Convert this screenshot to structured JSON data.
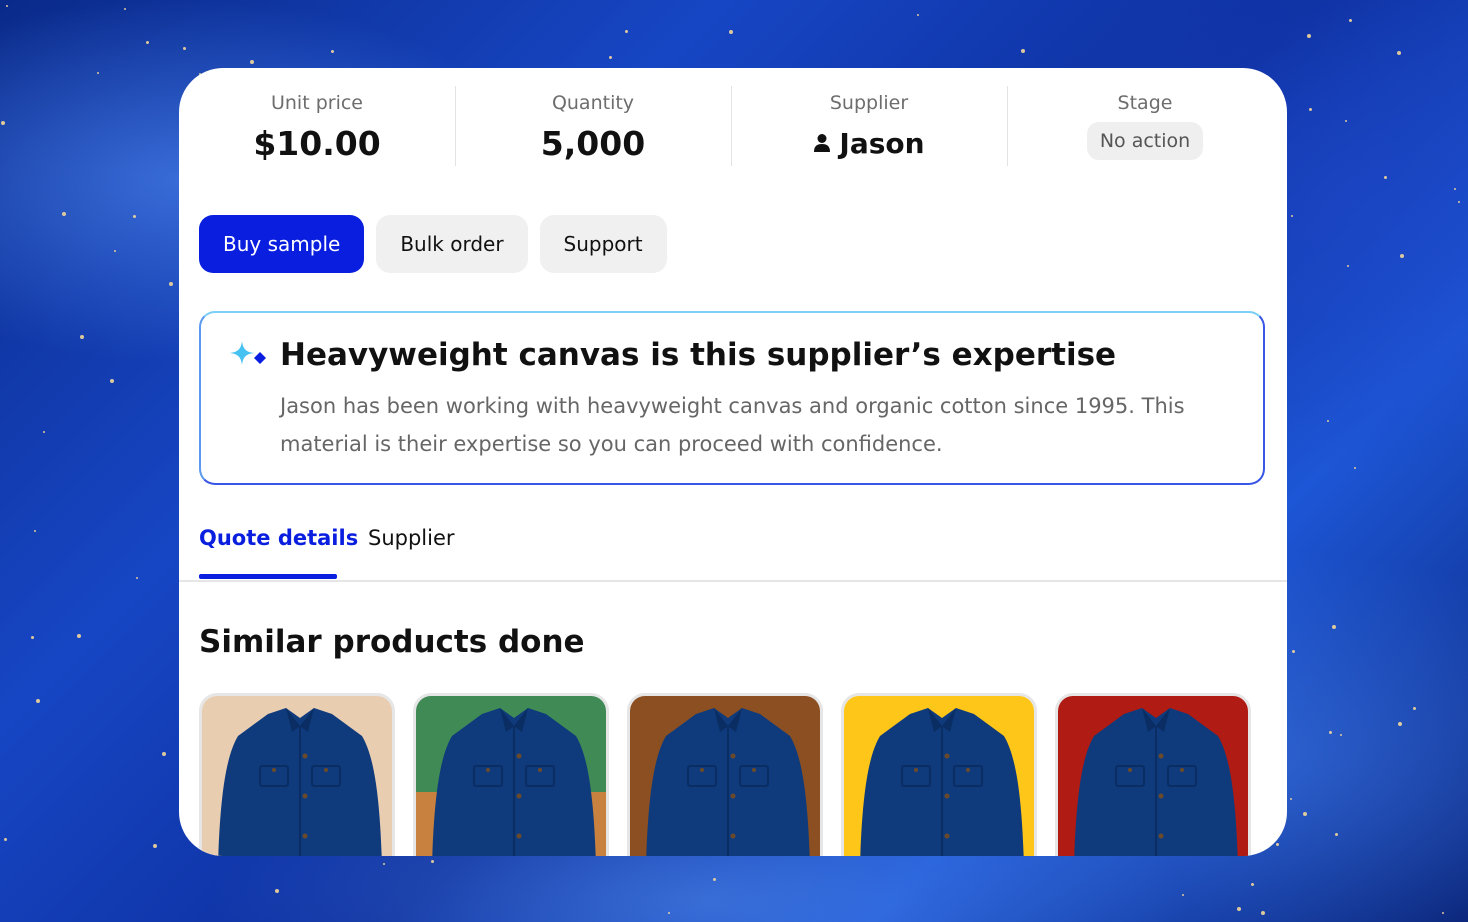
{
  "stats": {
    "unit_price": {
      "label": "Unit price",
      "value": "$10.00"
    },
    "quantity": {
      "label": "Quantity",
      "value": "5,000"
    },
    "supplier": {
      "label": "Supplier",
      "value": "Jason",
      "icon": "person-icon"
    },
    "stage": {
      "label": "Stage",
      "value": "No action"
    }
  },
  "actions": {
    "buy_sample": "Buy sample",
    "bulk_order": "Bulk order",
    "support": "Support"
  },
  "insight": {
    "icon": "sparkle-icon",
    "title": "Heavyweight canvas is this supplier’s expertise",
    "body": "Jason has been working with heavyweight canvas and organic cotton since 1995. This material is their expertise so you can proceed with confidence."
  },
  "tabs": [
    {
      "label": "Quote details",
      "active": true
    },
    {
      "label": "Supplier",
      "active": false
    }
  ],
  "similar": {
    "title": "Similar products done",
    "products": [
      {
        "background": "#e8cdb1",
        "background_bottom": "#e8cdb1"
      },
      {
        "background": "#3f8a55",
        "background_bottom": "#c9813f"
      },
      {
        "background": "#8b4f22",
        "background_bottom": "#8b4f22"
      },
      {
        "background": "#ffc61a",
        "background_bottom": "#ffc61a"
      },
      {
        "background": "#b01b14",
        "background_bottom": "#b01b14"
      }
    ],
    "jacket_color": "#0f3b7c"
  },
  "colors": {
    "accent": "#0a1ee0"
  }
}
